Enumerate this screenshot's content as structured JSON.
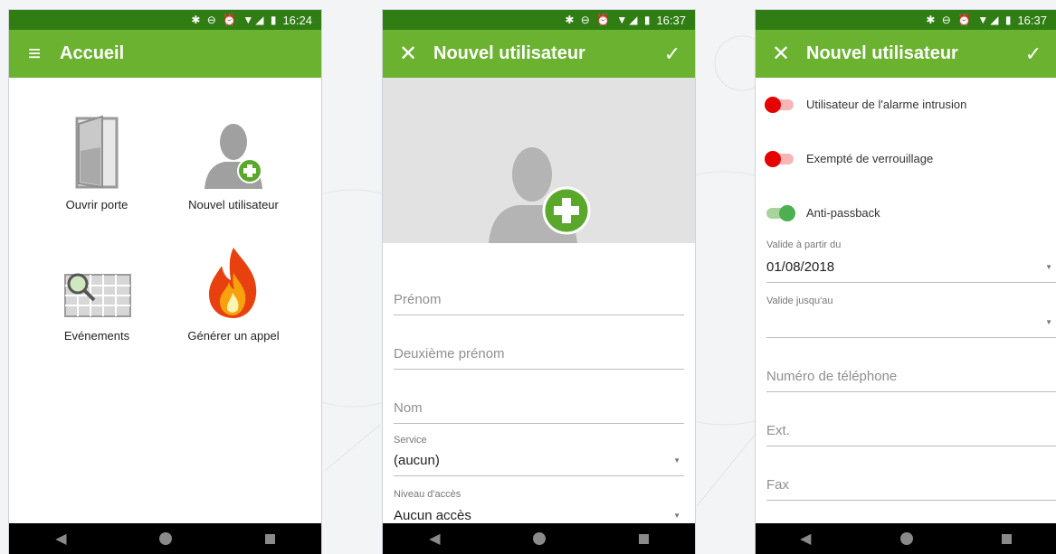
{
  "status": {
    "screen1_time": "16:24",
    "screen2_time": "16:37",
    "screen3_time": "16:37",
    "icons": "✱ ⊖ ⏰ ▼◢ ▮"
  },
  "screen1": {
    "title": "Accueil",
    "tiles": [
      {
        "label": "Ouvrir porte",
        "icon": "door-icon"
      },
      {
        "label": "Nouvel utilisateur",
        "icon": "add-user-icon"
      },
      {
        "label": "Evénements",
        "icon": "events-calendar-icon"
      },
      {
        "label": "Générer un appel",
        "icon": "fire-icon"
      }
    ]
  },
  "screen2": {
    "title": "Nouvel utilisateur",
    "fields": {
      "first_name_placeholder": "Prénom",
      "middle_name_placeholder": "Deuxième prénom",
      "last_name_placeholder": "Nom",
      "service_label": "Service",
      "service_value": "(aucun)",
      "access_label": "Niveau d'accès",
      "access_value": "Aucun accès"
    }
  },
  "screen3": {
    "title": "Nouvel utilisateur",
    "toggles": [
      {
        "label": "Utilisateur de l'alarme intrusion",
        "state": "off"
      },
      {
        "label": "Exempté de verrouillage",
        "state": "off"
      },
      {
        "label": "Anti-passback",
        "state": "on"
      }
    ],
    "valid_from_label": "Valide à partir du",
    "valid_from_value": "01/08/2018",
    "valid_to_label": "Valide jusqu'au",
    "valid_to_value": "",
    "phone_placeholder": "Numéro de téléphone",
    "ext_placeholder": "Ext.",
    "fax_placeholder": "Fax"
  },
  "colors": {
    "statusbar": "#2f7d13",
    "appbar": "#6ab22f",
    "toggle_off": "#e60000",
    "toggle_on": "#4caf50"
  }
}
